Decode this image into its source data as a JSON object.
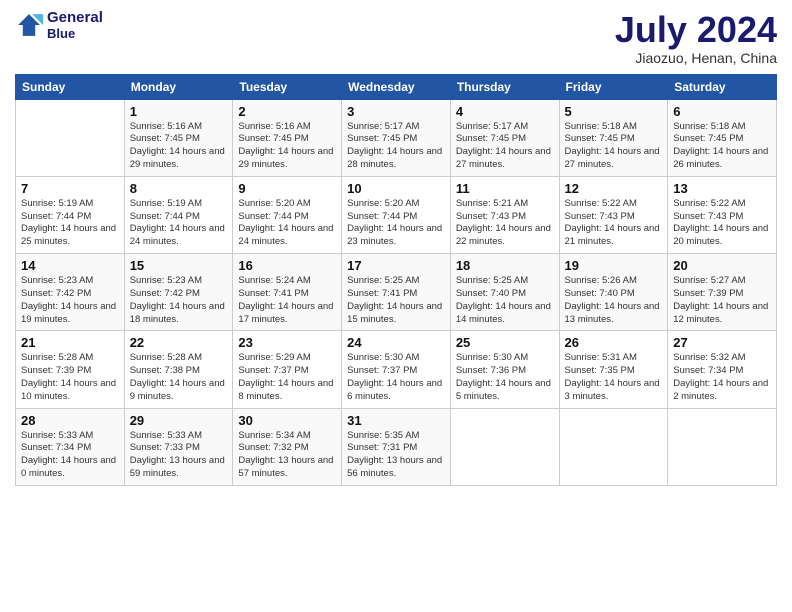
{
  "header": {
    "logo_line1": "General",
    "logo_line2": "Blue",
    "month": "July 2024",
    "location": "Jiaozuo, Henan, China"
  },
  "days_of_week": [
    "Sunday",
    "Monday",
    "Tuesday",
    "Wednesday",
    "Thursday",
    "Friday",
    "Saturday"
  ],
  "weeks": [
    [
      {
        "day": "",
        "content": ""
      },
      {
        "day": "1",
        "content": "Sunrise: 5:16 AM\nSunset: 7:45 PM\nDaylight: 14 hours and 29 minutes."
      },
      {
        "day": "2",
        "content": "Sunrise: 5:16 AM\nSunset: 7:45 PM\nDaylight: 14 hours and 29 minutes."
      },
      {
        "day": "3",
        "content": "Sunrise: 5:17 AM\nSunset: 7:45 PM\nDaylight: 14 hours and 28 minutes."
      },
      {
        "day": "4",
        "content": "Sunrise: 5:17 AM\nSunset: 7:45 PM\nDaylight: 14 hours and 27 minutes."
      },
      {
        "day": "5",
        "content": "Sunrise: 5:18 AM\nSunset: 7:45 PM\nDaylight: 14 hours and 27 minutes."
      },
      {
        "day": "6",
        "content": "Sunrise: 5:18 AM\nSunset: 7:45 PM\nDaylight: 14 hours and 26 minutes."
      }
    ],
    [
      {
        "day": "7",
        "content": "Sunrise: 5:19 AM\nSunset: 7:44 PM\nDaylight: 14 hours and 25 minutes."
      },
      {
        "day": "8",
        "content": "Sunrise: 5:19 AM\nSunset: 7:44 PM\nDaylight: 14 hours and 24 minutes."
      },
      {
        "day": "9",
        "content": "Sunrise: 5:20 AM\nSunset: 7:44 PM\nDaylight: 14 hours and 24 minutes."
      },
      {
        "day": "10",
        "content": "Sunrise: 5:20 AM\nSunset: 7:44 PM\nDaylight: 14 hours and 23 minutes."
      },
      {
        "day": "11",
        "content": "Sunrise: 5:21 AM\nSunset: 7:43 PM\nDaylight: 14 hours and 22 minutes."
      },
      {
        "day": "12",
        "content": "Sunrise: 5:22 AM\nSunset: 7:43 PM\nDaylight: 14 hours and 21 minutes."
      },
      {
        "day": "13",
        "content": "Sunrise: 5:22 AM\nSunset: 7:43 PM\nDaylight: 14 hours and 20 minutes."
      }
    ],
    [
      {
        "day": "14",
        "content": "Sunrise: 5:23 AM\nSunset: 7:42 PM\nDaylight: 14 hours and 19 minutes."
      },
      {
        "day": "15",
        "content": "Sunrise: 5:23 AM\nSunset: 7:42 PM\nDaylight: 14 hours and 18 minutes."
      },
      {
        "day": "16",
        "content": "Sunrise: 5:24 AM\nSunset: 7:41 PM\nDaylight: 14 hours and 17 minutes."
      },
      {
        "day": "17",
        "content": "Sunrise: 5:25 AM\nSunset: 7:41 PM\nDaylight: 14 hours and 15 minutes."
      },
      {
        "day": "18",
        "content": "Sunrise: 5:25 AM\nSunset: 7:40 PM\nDaylight: 14 hours and 14 minutes."
      },
      {
        "day": "19",
        "content": "Sunrise: 5:26 AM\nSunset: 7:40 PM\nDaylight: 14 hours and 13 minutes."
      },
      {
        "day": "20",
        "content": "Sunrise: 5:27 AM\nSunset: 7:39 PM\nDaylight: 14 hours and 12 minutes."
      }
    ],
    [
      {
        "day": "21",
        "content": "Sunrise: 5:28 AM\nSunset: 7:39 PM\nDaylight: 14 hours and 10 minutes."
      },
      {
        "day": "22",
        "content": "Sunrise: 5:28 AM\nSunset: 7:38 PM\nDaylight: 14 hours and 9 minutes."
      },
      {
        "day": "23",
        "content": "Sunrise: 5:29 AM\nSunset: 7:37 PM\nDaylight: 14 hours and 8 minutes."
      },
      {
        "day": "24",
        "content": "Sunrise: 5:30 AM\nSunset: 7:37 PM\nDaylight: 14 hours and 6 minutes."
      },
      {
        "day": "25",
        "content": "Sunrise: 5:30 AM\nSunset: 7:36 PM\nDaylight: 14 hours and 5 minutes."
      },
      {
        "day": "26",
        "content": "Sunrise: 5:31 AM\nSunset: 7:35 PM\nDaylight: 14 hours and 3 minutes."
      },
      {
        "day": "27",
        "content": "Sunrise: 5:32 AM\nSunset: 7:34 PM\nDaylight: 14 hours and 2 minutes."
      }
    ],
    [
      {
        "day": "28",
        "content": "Sunrise: 5:33 AM\nSunset: 7:34 PM\nDaylight: 14 hours and 0 minutes."
      },
      {
        "day": "29",
        "content": "Sunrise: 5:33 AM\nSunset: 7:33 PM\nDaylight: 13 hours and 59 minutes."
      },
      {
        "day": "30",
        "content": "Sunrise: 5:34 AM\nSunset: 7:32 PM\nDaylight: 13 hours and 57 minutes."
      },
      {
        "day": "31",
        "content": "Sunrise: 5:35 AM\nSunset: 7:31 PM\nDaylight: 13 hours and 56 minutes."
      },
      {
        "day": "",
        "content": ""
      },
      {
        "day": "",
        "content": ""
      },
      {
        "day": "",
        "content": ""
      }
    ]
  ]
}
